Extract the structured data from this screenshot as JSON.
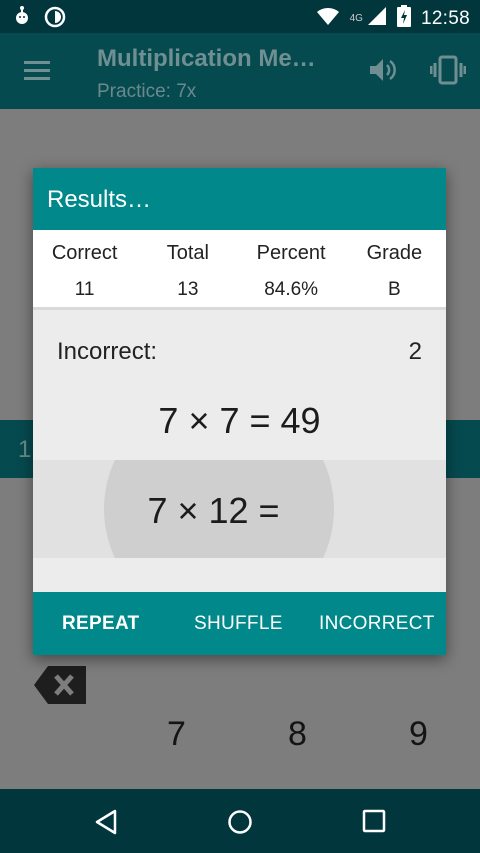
{
  "status_bar": {
    "time": "12:58",
    "network_label": "4G",
    "icons": [
      "android-debug-icon",
      "data-saver-icon",
      "wifi-icon",
      "signal-icon",
      "battery-charging-icon"
    ]
  },
  "app_bar": {
    "title": "Multiplication Me…",
    "subtitle": "Practice: 7x",
    "icons": [
      "menu-icon",
      "volume-icon",
      "vibrate-icon"
    ]
  },
  "background": {
    "band_digit": "1",
    "keypad": [
      "7",
      "8",
      "9"
    ]
  },
  "dialog": {
    "title": "Results…",
    "stats": [
      {
        "label": "Correct",
        "value": "11"
      },
      {
        "label": "Total",
        "value": "13"
      },
      {
        "label": "Percent",
        "value": "84.6%"
      },
      {
        "label": "Grade",
        "value": "B"
      }
    ],
    "incorrect_label": "Incorrect:",
    "incorrect_count": "2",
    "incorrect_items": [
      "7 × 7 = 49",
      "7 × 12 ="
    ],
    "buttons": {
      "repeat": "REPEAT",
      "shuffle": "SHUFFLE",
      "incorrect": "INCORRECT"
    }
  },
  "nav_bar": {
    "icons": [
      "back-icon",
      "home-icon",
      "recents-icon"
    ]
  },
  "colors": {
    "accent": "#00888a",
    "status_bar": "#00363c",
    "app_bar_dimmed": "#054a4f"
  }
}
